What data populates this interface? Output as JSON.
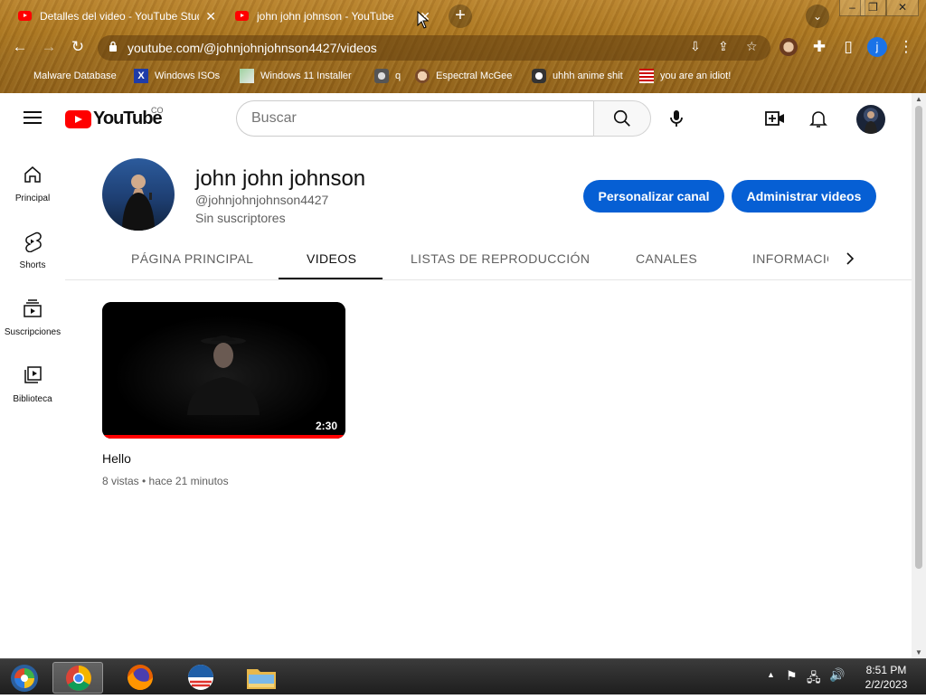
{
  "browser": {
    "tabs": [
      {
        "title": "Detalles del video - YouTube Studio"
      },
      {
        "title": "john john johnson - YouTube"
      }
    ],
    "url": "youtube.com/@johnjohnjohnson4427/videos",
    "bookmarks": [
      {
        "label": "Malware Database"
      },
      {
        "label": "Windows ISOs"
      },
      {
        "label": "Windows 11 Installer"
      },
      {
        "label": "q"
      },
      {
        "label": "Espectral McGee"
      },
      {
        "label": "uhhh anime shit"
      },
      {
        "label": "you are an idiot!"
      }
    ],
    "profile_initial": "j"
  },
  "youtube": {
    "logo_text": "YouTube",
    "country_code": "CO",
    "search_placeholder": "Buscar",
    "sidebar": [
      {
        "label": "Principal",
        "icon": "home-icon"
      },
      {
        "label": "Shorts",
        "icon": "shorts-icon"
      },
      {
        "label": "Suscripciones",
        "icon": "subscriptions-icon"
      },
      {
        "label": "Biblioteca",
        "icon": "library-icon"
      }
    ],
    "channel": {
      "name": "john john johnson",
      "handle": "@johnjohnjohnson4427",
      "subscribers": "Sin suscriptores",
      "customize_label": "Personalizar canal",
      "manage_label": "Administrar videos"
    },
    "tabs": [
      {
        "label": "PÁGINA PRINCIPAL"
      },
      {
        "label": "VIDEOS"
      },
      {
        "label": "LISTAS DE REPRODUCCIÓN"
      },
      {
        "label": "CANALES"
      },
      {
        "label": "INFORMACIÓN"
      }
    ],
    "active_tab": "VIDEOS",
    "videos": [
      {
        "title": "Hello",
        "duration": "2:30",
        "meta": "8 vistas • hace 21 minutos",
        "watched_fraction": 1.0
      }
    ],
    "colors": {
      "brand_red": "#ff0000",
      "button_blue": "#065fd4"
    }
  },
  "taskbar": {
    "time": "8:51 PM",
    "date": "2/2/2023"
  }
}
